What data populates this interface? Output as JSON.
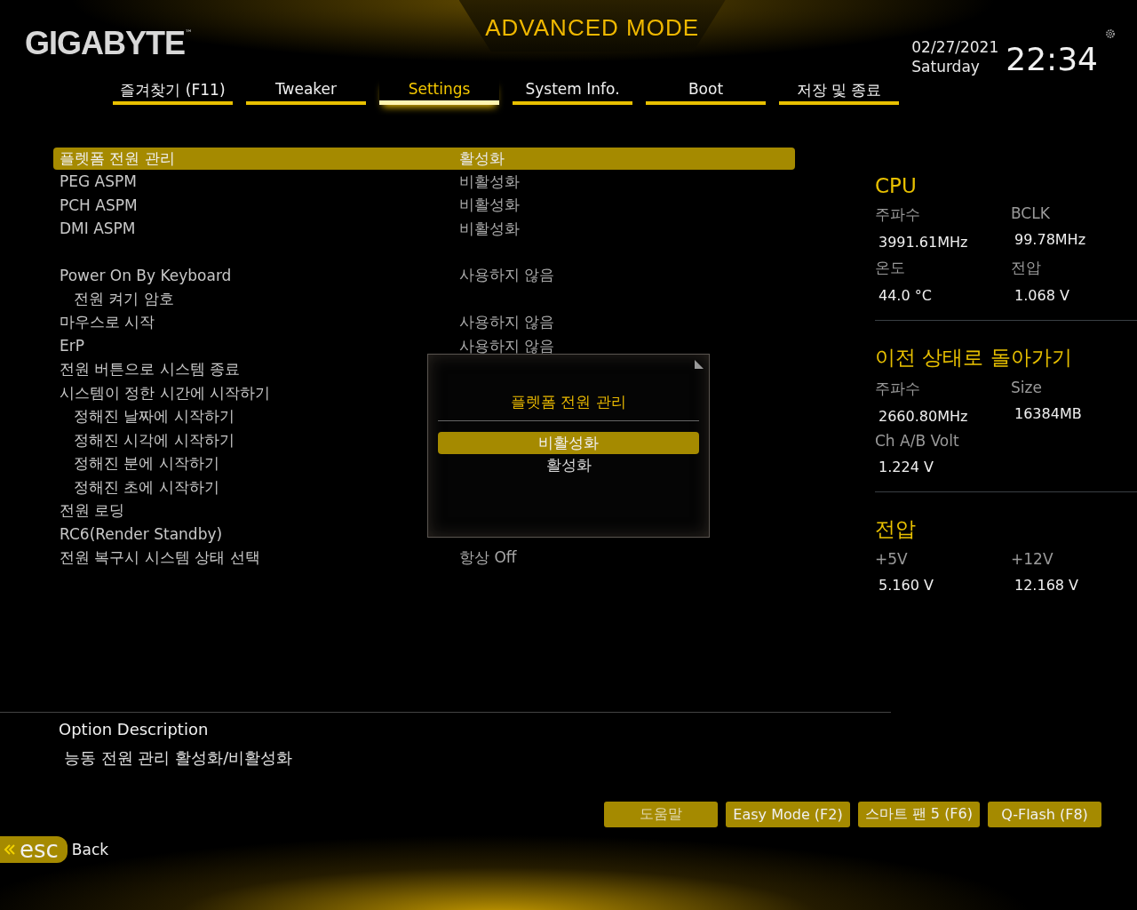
{
  "header": {
    "brand": "GIGABYTE",
    "trademark": "™",
    "mode_title": "ADVANCED MODE",
    "date": "02/27/2021",
    "day": "Saturday",
    "time": "22:34"
  },
  "tabs": [
    {
      "label": "즐겨찾기 (F11)",
      "selected": false
    },
    {
      "label": "Tweaker",
      "selected": false
    },
    {
      "label": "Settings",
      "selected": true
    },
    {
      "label": "System Info.",
      "selected": false
    },
    {
      "label": "Boot",
      "selected": false
    },
    {
      "label": "저장 및 종료",
      "selected": false
    }
  ],
  "settings": [
    {
      "rows": [
        {
          "label": "플렛폼 전원 관리",
          "value": "활성화",
          "selected": true
        },
        {
          "label": "PEG ASPM",
          "value": "비활성화",
          "selected": false
        },
        {
          "label": "PCH ASPM",
          "value": "비활성화",
          "selected": false
        },
        {
          "label": "DMI ASPM",
          "value": "비활성화",
          "selected": false
        }
      ]
    },
    {
      "rows": [
        {
          "label": "Power On By Keyboard",
          "value": "사용하지 않음",
          "selected": false
        },
        {
          "label": "전원 켜기 암호",
          "selected": false,
          "indent": true
        },
        {
          "label": "마우스로 시작",
          "value": "사용하지 않음",
          "selected": false
        },
        {
          "label": "ErP",
          "value": "사용하지 않음",
          "selected": false
        },
        {
          "label": "전원 버튼으로 시스템 종료",
          "selected": false
        },
        {
          "label": "시스템이 정한 시간에 시작하기",
          "selected": false
        },
        {
          "label": "정해진 날짜에 시작하기",
          "selected": false,
          "indent": true
        },
        {
          "label": "정해진 시각에 시작하기",
          "selected": false,
          "indent": true
        },
        {
          "label": "정해진 분에 시작하기",
          "selected": false,
          "indent": true
        },
        {
          "label": "정해진 초에 시작하기",
          "selected": false,
          "indent": true
        },
        {
          "label": "전원 로딩",
          "selected": false
        },
        {
          "label": "RC6(Render Standby)",
          "selected": false
        },
        {
          "label": "전원 복구시 시스템 상태 선택",
          "value": "항상 Off",
          "selected": false
        }
      ]
    }
  ],
  "popup": {
    "title": "플렛폼 전원 관리",
    "options": [
      {
        "label": "비활성화",
        "selected": true
      },
      {
        "label": "활성화",
        "selected": false
      }
    ]
  },
  "monitor": [
    {
      "title": "CPU",
      "fields": [
        {
          "label": "주파수",
          "value": "3991.61MHz"
        },
        {
          "label": "BCLK",
          "value": "99.78MHz"
        },
        {
          "label": "온도",
          "value": "44.0 °C"
        },
        {
          "label": "전압",
          "value": "1.068 V"
        }
      ]
    },
    {
      "title": "이전 상태로 돌아가기",
      "fields": [
        {
          "label": "주파수",
          "value": "2660.80MHz"
        },
        {
          "label": "Size",
          "value": "16384MB"
        },
        {
          "label": "Ch A/B Volt",
          "value": "1.224 V"
        }
      ]
    },
    {
      "title": "전압",
      "fields": [
        {
          "label": "+5V",
          "value": "5.160 V"
        },
        {
          "label": "+12V",
          "value": "12.168 V"
        }
      ]
    }
  ],
  "description": {
    "heading": "Option Description",
    "text": "능동 전원 관리 활성화/비활성화"
  },
  "buttons": [
    "도움말",
    "Easy Mode (F2)",
    "스마트 팬 5 (F6)",
    "Q-Flash (F8)"
  ],
  "back": {
    "key": "esc",
    "label": "Back"
  }
}
